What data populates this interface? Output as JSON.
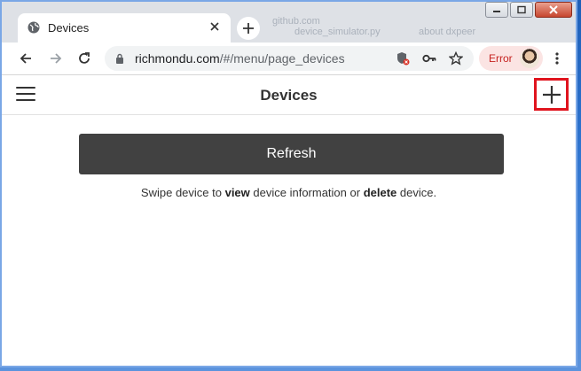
{
  "browser": {
    "tab": {
      "title": "Devices"
    },
    "background_tabs": [
      "github.com",
      "device_simulator.py",
      "about dxpeer"
    ],
    "address": {
      "host": "richmondu.com",
      "path": "/#/menu/page_devices"
    },
    "profile": {
      "status": "Error"
    }
  },
  "app": {
    "title": "Devices",
    "refresh_label": "Refresh",
    "hint": {
      "part1": "Swipe device to ",
      "bold1": "view",
      "part2": " device information or ",
      "bold2": "delete",
      "part3": " device."
    }
  },
  "colors": {
    "highlight": "#e0141e",
    "refresh_bg": "#414141",
    "error_text": "#c5221f"
  },
  "icons": [
    "globe-icon",
    "close-icon",
    "plus-icon",
    "back-icon",
    "forward-icon",
    "reload-icon",
    "lock-icon",
    "shield-blocked-icon",
    "key-icon",
    "star-icon",
    "more-vert-icon",
    "hamburger-icon",
    "add-icon"
  ]
}
